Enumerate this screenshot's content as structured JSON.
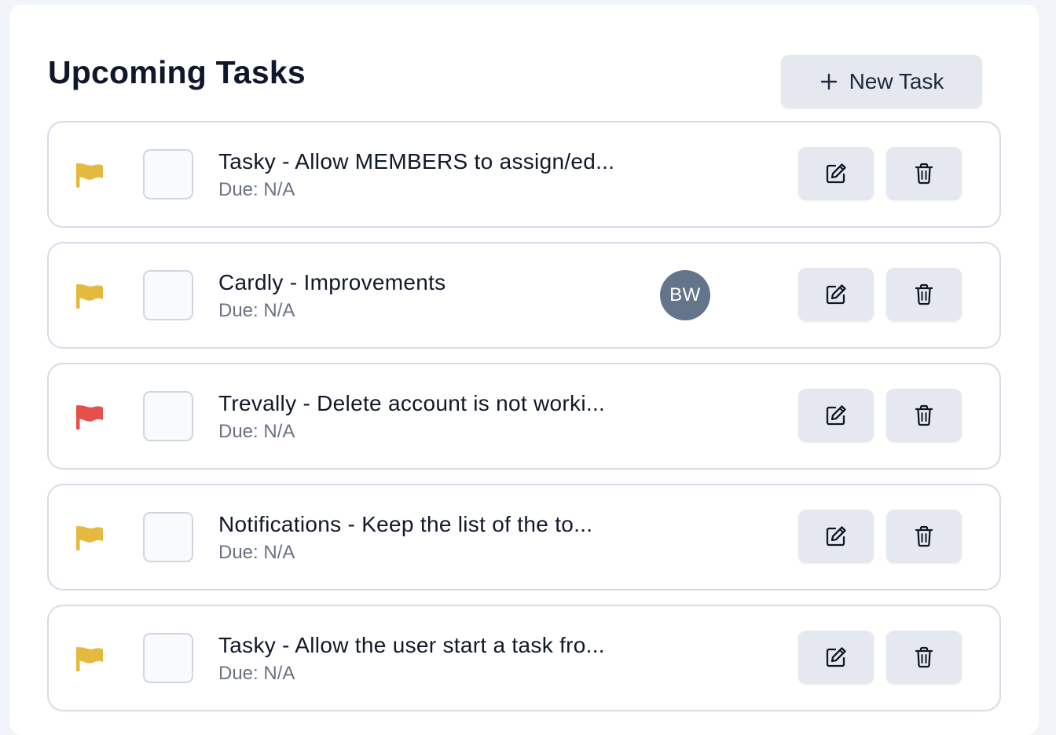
{
  "header": {
    "title": "Upcoming Tasks",
    "new_task_label": "New Task"
  },
  "colors": {
    "priority_medium": "#e5b93d",
    "priority_high": "#e5504b",
    "avatar_bg": "#64748b",
    "button_bg": "#e5e9ef"
  },
  "icons": {
    "new_task": "plus-icon",
    "priority": "flag-icon",
    "edit": "edit-icon",
    "delete": "trash-icon"
  },
  "tasks": [
    {
      "title": "Tasky - Allow MEMBERS to assign/ed...",
      "due": "Due: N/A",
      "priority": "medium",
      "completed": false,
      "assignee": ""
    },
    {
      "title": "Cardly - Improvements",
      "due": "Due: N/A",
      "priority": "medium",
      "completed": false,
      "assignee": "BW"
    },
    {
      "title": "Trevally - Delete account is not worki...",
      "due": "Due: N/A",
      "priority": "high",
      "completed": false,
      "assignee": ""
    },
    {
      "title": "Notifications - Keep the list of the to...",
      "due": "Due: N/A",
      "priority": "medium",
      "completed": false,
      "assignee": ""
    },
    {
      "title": "Tasky - Allow the user start a task fro...",
      "due": "Due: N/A",
      "priority": "medium",
      "completed": false,
      "assignee": ""
    }
  ]
}
